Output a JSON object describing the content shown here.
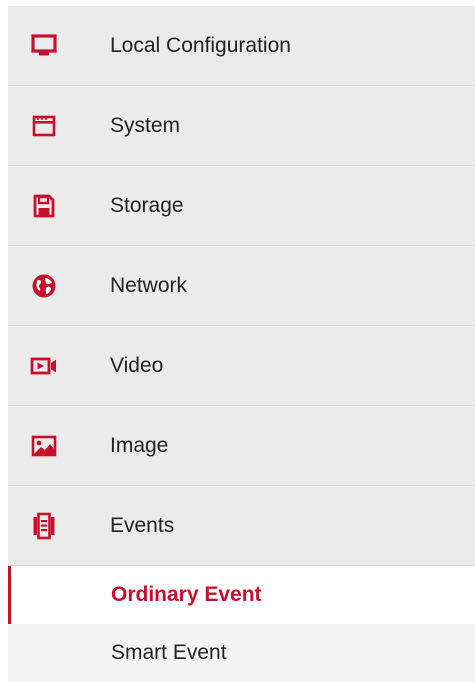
{
  "accent_color": "#c8102e",
  "menu": {
    "items": [
      {
        "label": "Local Configuration",
        "icon": "monitor-icon"
      },
      {
        "label": "System",
        "icon": "system-window-icon"
      },
      {
        "label": "Storage",
        "icon": "floppy-disk-icon"
      },
      {
        "label": "Network",
        "icon": "globe-icon"
      },
      {
        "label": "Video",
        "icon": "video-camera-icon"
      },
      {
        "label": "Image",
        "icon": "picture-icon"
      },
      {
        "label": "Events",
        "icon": "events-list-icon"
      }
    ],
    "events_submenu": {
      "items": [
        {
          "label": "Ordinary Event",
          "active": true
        },
        {
          "label": "Smart Event",
          "active": false
        }
      ]
    }
  }
}
